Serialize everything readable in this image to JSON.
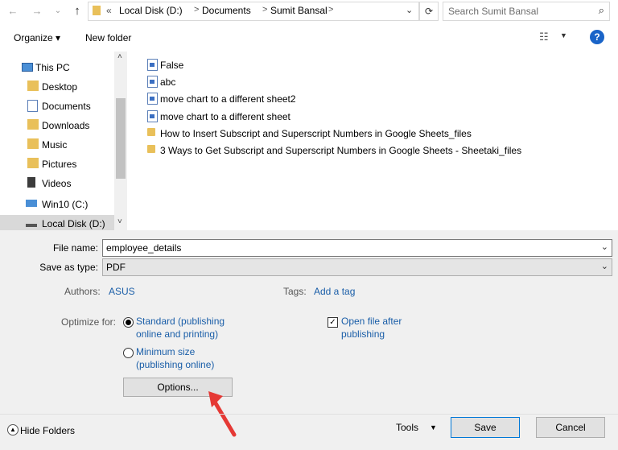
{
  "address": {
    "breadcrumbs": [
      "«",
      "Local Disk (D:)",
      "Documents",
      "Sumit Bansal"
    ],
    "search_placeholder": "Search Sumit Bansal"
  },
  "toolbar": {
    "organize_label": "Organize ▾",
    "new_folder_label": "New folder",
    "help_label": "?"
  },
  "nav": {
    "items": [
      {
        "label": "This PC"
      },
      {
        "label": "Desktop"
      },
      {
        "label": "Documents"
      },
      {
        "label": "Downloads"
      },
      {
        "label": "Music"
      },
      {
        "label": "Pictures"
      },
      {
        "label": "Videos"
      },
      {
        "label": "Win10 (C:)"
      },
      {
        "label": "Local Disk (D:)"
      }
    ]
  },
  "files": [
    {
      "name": "False",
      "type": "doc"
    },
    {
      "name": "abc",
      "type": "doc"
    },
    {
      "name": "move chart to a different sheet2",
      "type": "doc"
    },
    {
      "name": "move chart to a different sheet",
      "type": "doc"
    },
    {
      "name": "How to Insert Subscript and Superscript Numbers in Google Sheets_files",
      "type": "folder"
    },
    {
      "name": "3 Ways to Get Subscript and Superscript Numbers in Google Sheets - Sheetaki_files",
      "type": "folder"
    }
  ],
  "form": {
    "file_name_label": "File name:",
    "file_name_value": "employee_details",
    "save_type_label": "Save as type:",
    "save_type_value": "PDF",
    "authors_label": "Authors:",
    "authors_value": "ASUS",
    "tags_label": "Tags:",
    "tags_value": "Add a tag",
    "optimize_label": "Optimize for:",
    "standard_line1": "Standard (publishing",
    "standard_line2": "online and printing)",
    "minimum_line1": "Minimum size",
    "minimum_line2": "(publishing online)",
    "open_after_line1": "Open file after",
    "open_after_line2": "publishing",
    "options_label": "Options..."
  },
  "footer": {
    "hide_folders_label": "Hide Folders",
    "tools_label": "Tools",
    "save_label": "Save",
    "cancel_label": "Cancel"
  }
}
